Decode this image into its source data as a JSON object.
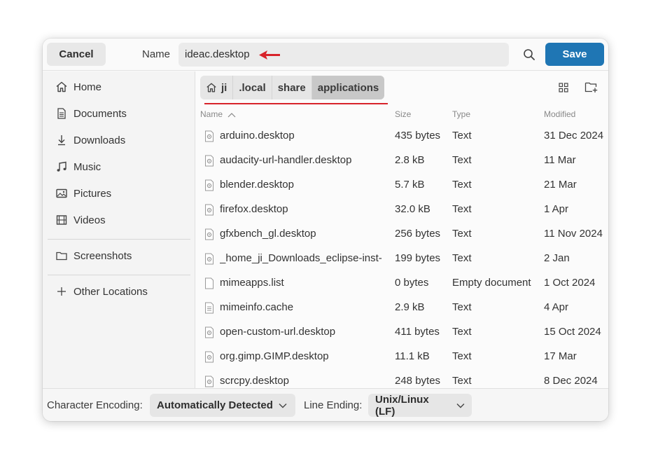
{
  "header": {
    "cancel_label": "Cancel",
    "name_label": "Name",
    "name_value": "ideac.desktop",
    "save_label": "Save"
  },
  "sidebar": {
    "items": [
      {
        "label": "Home",
        "icon": "home-icon"
      },
      {
        "label": "Documents",
        "icon": "document-icon"
      },
      {
        "label": "Downloads",
        "icon": "download-icon"
      },
      {
        "label": "Music",
        "icon": "music-icon"
      },
      {
        "label": "Pictures",
        "icon": "pictures-icon"
      },
      {
        "label": "Videos",
        "icon": "video-icon"
      },
      {
        "label": "Screenshots",
        "icon": "folder-icon"
      },
      {
        "label": "Other Locations",
        "icon": "plus-icon"
      }
    ]
  },
  "pathbar": {
    "crumbs": [
      "ji",
      ".local",
      "share",
      "applications"
    ]
  },
  "columns": {
    "name": "Name",
    "size": "Size",
    "type": "Type",
    "modified": "Modified"
  },
  "files": [
    {
      "name": "arduino.desktop",
      "size": "435 bytes",
      "type": "Text",
      "modified": "31 Dec 2024",
      "icon": "desktop-file-icon"
    },
    {
      "name": "audacity-url-handler.desktop",
      "size": "2.8 kB",
      "type": "Text",
      "modified": "11 Mar",
      "icon": "desktop-file-icon"
    },
    {
      "name": "blender.desktop",
      "size": "5.7 kB",
      "type": "Text",
      "modified": "21 Mar",
      "icon": "desktop-file-icon"
    },
    {
      "name": "firefox.desktop",
      "size": "32.0 kB",
      "type": "Text",
      "modified": "1 Apr",
      "icon": "desktop-file-icon"
    },
    {
      "name": "gfxbench_gl.desktop",
      "size": "256 bytes",
      "type": "Text",
      "modified": "11 Nov 2024",
      "icon": "desktop-file-icon"
    },
    {
      "name": "_home_ji_Downloads_eclipse-inst-",
      "size": "199 bytes",
      "type": "Text",
      "modified": "2 Jan",
      "icon": "desktop-file-icon"
    },
    {
      "name": "mimeapps.list",
      "size": "0 bytes",
      "type": "Empty document",
      "modified": "1 Oct 2024",
      "icon": "empty-file-icon"
    },
    {
      "name": "mimeinfo.cache",
      "size": "2.9 kB",
      "type": "Text",
      "modified": "4 Apr",
      "icon": "text-file-icon"
    },
    {
      "name": "open-custom-url.desktop",
      "size": "411 bytes",
      "type": "Text",
      "modified": "15 Oct 2024",
      "icon": "desktop-file-icon"
    },
    {
      "name": "org.gimp.GIMP.desktop",
      "size": "11.1 kB",
      "type": "Text",
      "modified": "17 Mar",
      "icon": "desktop-file-icon"
    },
    {
      "name": "scrcpy.desktop",
      "size": "248 bytes",
      "type": "Text",
      "modified": "8 Dec 2024",
      "icon": "desktop-file-icon"
    }
  ],
  "footer": {
    "encoding_label": "Character Encoding:",
    "encoding_value": "Automatically Detected",
    "line_ending_label": "Line Ending:",
    "line_ending_value": "Unix/Linux (LF)"
  },
  "colors": {
    "accent": "#1f76b4",
    "annotation": "#d8232a"
  }
}
